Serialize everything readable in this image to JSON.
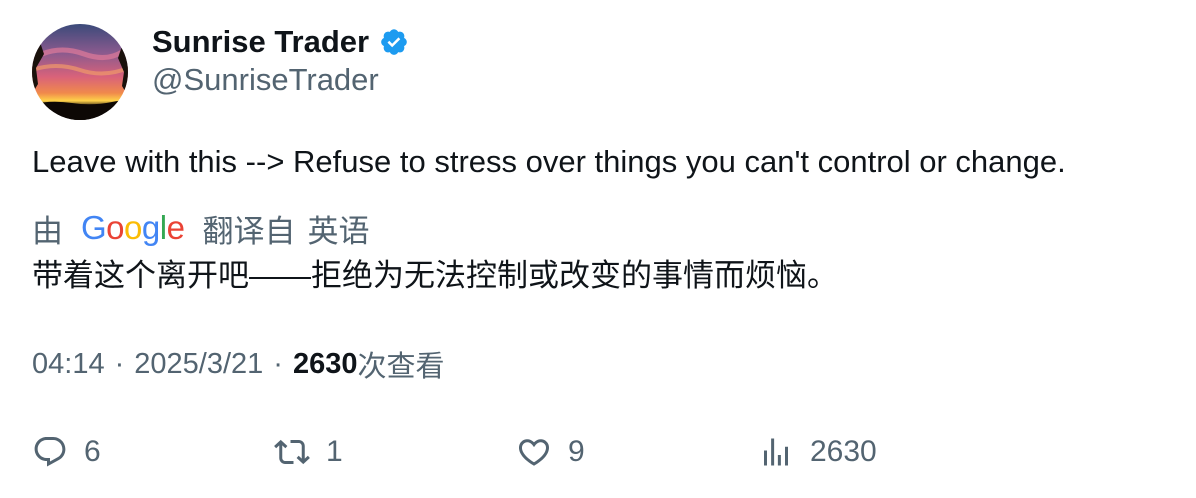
{
  "author": {
    "display_name": "Sunrise Trader",
    "handle": "@SunriseTrader",
    "verified": true,
    "avatar_icon": "sunset-landscape-avatar",
    "verified_color": "#1d9bf0"
  },
  "tweet": {
    "text": "Leave with this --> Refuse to stress over things you can't control or change.",
    "translation": {
      "prefix": "由",
      "provider_logo": "Google",
      "suffix": "翻译自",
      "language": "英语",
      "text": "带着这个离开吧——拒绝为无法控制或改变的事情而烦恼。"
    },
    "time": "04:14",
    "separator": "·",
    "date": "2025/3/21",
    "views_count": "2630",
    "views_label": "次查看"
  },
  "actions": {
    "reply": {
      "icon": "reply-icon",
      "count": "6"
    },
    "retweet": {
      "icon": "retweet-icon",
      "count": "1"
    },
    "like": {
      "icon": "heart-icon",
      "count": "9"
    },
    "views": {
      "icon": "analytics-icon",
      "count": "2630"
    }
  },
  "colors": {
    "text_primary": "#0f1419",
    "text_secondary": "#536471",
    "google_blue": "#4285F4",
    "google_red": "#EA4335",
    "google_yellow": "#FBBC05",
    "google_green": "#34A853"
  }
}
